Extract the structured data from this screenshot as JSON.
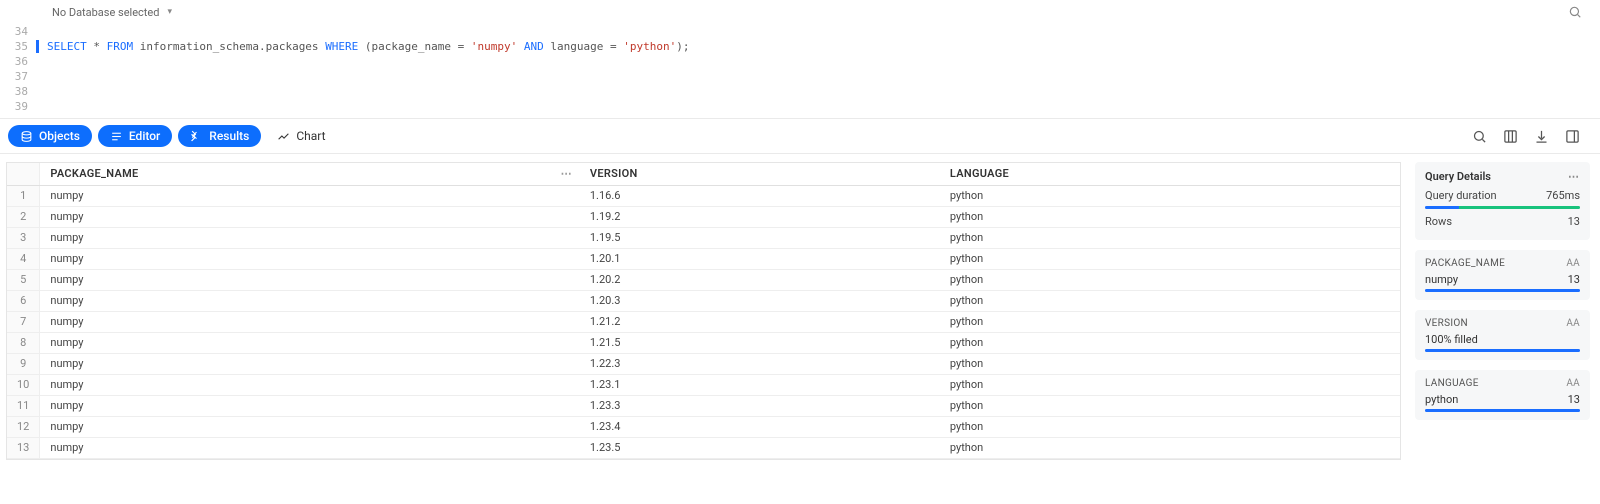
{
  "topbar": {
    "db_label": "No Database selected",
    "caret": "▾"
  },
  "editor": {
    "lines": [
      "34",
      "35",
      "36",
      "37",
      "38",
      "39"
    ],
    "sql_tokens": [
      {
        "t": "SELECT",
        "c": "kw"
      },
      {
        "t": " * ",
        "c": "ident"
      },
      {
        "t": "FROM",
        "c": "kw"
      },
      {
        "t": " information_schema.packages ",
        "c": "ident"
      },
      {
        "t": "WHERE",
        "c": "kw"
      },
      {
        "t": " (package_name = ",
        "c": "ident"
      },
      {
        "t": "'numpy'",
        "c": "str"
      },
      {
        "t": " ",
        "c": "ident"
      },
      {
        "t": "AND",
        "c": "kw"
      },
      {
        "t": " language = ",
        "c": "ident"
      },
      {
        "t": "'python'",
        "c": "str"
      },
      {
        "t": ");",
        "c": "ident"
      }
    ]
  },
  "tabs": {
    "objects": "Objects",
    "editor": "Editor",
    "results": "Results",
    "chart": "Chart"
  },
  "table": {
    "headers": {
      "pkg": "PACKAGE_NAME",
      "ver": "VERSION",
      "lang": "LANGUAGE"
    },
    "rows": [
      {
        "n": "1",
        "pkg": "numpy",
        "ver": "1.16.6",
        "lang": "python"
      },
      {
        "n": "2",
        "pkg": "numpy",
        "ver": "1.19.2",
        "lang": "python"
      },
      {
        "n": "3",
        "pkg": "numpy",
        "ver": "1.19.5",
        "lang": "python"
      },
      {
        "n": "4",
        "pkg": "numpy",
        "ver": "1.20.1",
        "lang": "python"
      },
      {
        "n": "5",
        "pkg": "numpy",
        "ver": "1.20.2",
        "lang": "python"
      },
      {
        "n": "6",
        "pkg": "numpy",
        "ver": "1.20.3",
        "lang": "python"
      },
      {
        "n": "7",
        "pkg": "numpy",
        "ver": "1.21.2",
        "lang": "python"
      },
      {
        "n": "8",
        "pkg": "numpy",
        "ver": "1.21.5",
        "lang": "python"
      },
      {
        "n": "9",
        "pkg": "numpy",
        "ver": "1.22.3",
        "lang": "python"
      },
      {
        "n": "10",
        "pkg": "numpy",
        "ver": "1.23.1",
        "lang": "python"
      },
      {
        "n": "11",
        "pkg": "numpy",
        "ver": "1.23.3",
        "lang": "python"
      },
      {
        "n": "12",
        "pkg": "numpy",
        "ver": "1.23.4",
        "lang": "python"
      },
      {
        "n": "13",
        "pkg": "numpy",
        "ver": "1.23.5",
        "lang": "python"
      }
    ]
  },
  "details": {
    "title": "Query Details",
    "duration_label": "Query duration",
    "duration_value": "765ms",
    "rows_label": "Rows",
    "rows_value": "13",
    "bar_blue_pct": "22%",
    "bar_green_pct": "78%",
    "fields": [
      {
        "name": "PACKAGE_NAME",
        "value": "numpy",
        "count": "13",
        "type": "Aa",
        "bar": "100%"
      },
      {
        "name": "VERSION",
        "value": "100% filled",
        "count": "",
        "type": "Aa",
        "bar": "100%"
      },
      {
        "name": "LANGUAGE",
        "value": "python",
        "count": "13",
        "type": "Aa",
        "bar": "100%"
      }
    ]
  }
}
